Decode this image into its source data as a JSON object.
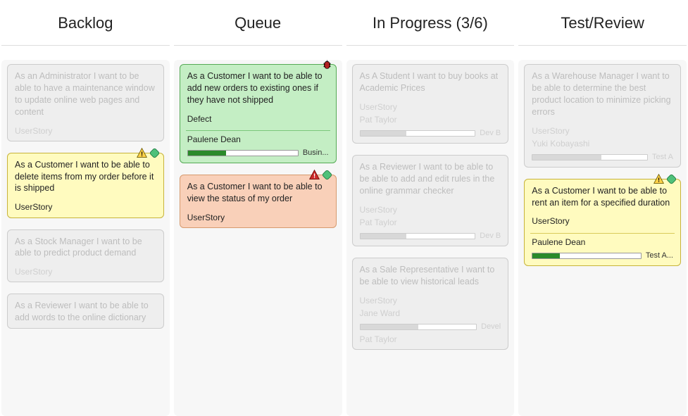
{
  "columns": [
    {
      "title": "Backlog",
      "cards": [
        {
          "text": "As an Administrator I want to be able to have a maintenance window to update online web pages and content",
          "type": "UserStory",
          "style": "dim",
          "owner": "",
          "progress": null
        },
        {
          "text": "As a Customer I want to be able to delete items from my order before it is shipped",
          "type": "UserStory",
          "style": "yellow",
          "badges": [
            "warn",
            "link"
          ]
        },
        {
          "text": "As a Stock Manager I want to be able to predict product demand",
          "type": "UserStory",
          "style": "dim"
        },
        {
          "text": "As a Reviewer I want to be able to add words to the online dictionary",
          "type": "",
          "style": "dim"
        }
      ]
    },
    {
      "title": "Queue",
      "cards": [
        {
          "text": "As a Customer I want to be able to add new orders to existing ones if they have not shipped",
          "type": "Defect",
          "style": "green",
          "owner": "Paulene Dean",
          "progress": 35,
          "tag": "Busin...",
          "badges": [
            "bug"
          ]
        },
        {
          "text": "As a Customer I want to be able to view the status of my order",
          "type": "UserStory",
          "style": "orange",
          "badges": [
            "alert",
            "link"
          ]
        }
      ]
    },
    {
      "title": "In Progress (3/6)",
      "cards": [
        {
          "text": "As A Student I want to buy books at Academic Prices",
          "type": "UserStory",
          "style": "dim",
          "owner": "Pat Taylor",
          "progress": 40,
          "tag": "Dev B"
        },
        {
          "text": "As a Reviewer I want to be able to be able to add and edit rules in the online grammar checker",
          "type": "UserStory",
          "style": "dim",
          "owner": "Pat Taylor",
          "progress": 40,
          "tag": "Dev B"
        },
        {
          "text": "As a Sale Representative I want to be able to view historical leads",
          "type": "UserStory",
          "style": "dim",
          "owner": "Jane Ward",
          "progress": 50,
          "tag": "Devel",
          "owner2": "Pat Taylor"
        }
      ]
    },
    {
      "title": "Test/Review",
      "cards": [
        {
          "text": "As a Warehouse Manager I want to be able to determine the best product location to minimize picking errors",
          "type": "UserStory",
          "style": "dim",
          "owner": "Yuki Kobayashi",
          "progress": 60,
          "tag": "Test A"
        },
        {
          "text": "As a Customer I want to be able to rent an item for a specified duration",
          "type": "UserStory",
          "style": "yellow",
          "owner": "Paulene Dean",
          "progress": 25,
          "tag": "Test A...",
          "badges": [
            "warn",
            "link"
          ]
        }
      ]
    }
  ]
}
